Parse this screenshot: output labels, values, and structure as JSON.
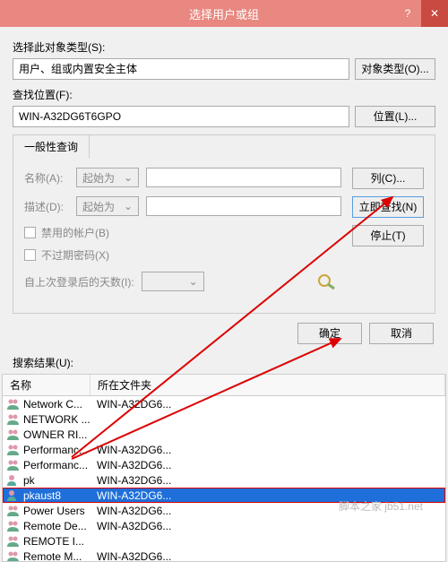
{
  "title": "选择用户或组",
  "section1": {
    "label": "选择此对象类型(S):",
    "value": "用户、组或内置安全主体",
    "btn": "对象类型(O)..."
  },
  "section2": {
    "label": "查找位置(F):",
    "value": "WIN-A32DG6T6GPO",
    "btn": "位置(L)..."
  },
  "tab": "一般性查询",
  "query": {
    "nameLabel": "名称(A):",
    "nameMode": "起始为",
    "descLabel": "描述(D):",
    "descMode": "起始为",
    "cb1": "禁用的帐户(B)",
    "cb2": "不过期密码(X)",
    "lastLogin": "自上次登录后的天数(I):"
  },
  "rightButtons": {
    "columns": "列(C)...",
    "findNow": "立即查找(N)",
    "stop": "停止(T)"
  },
  "dlg": {
    "ok": "确定",
    "cancel": "取消"
  },
  "resultsLabel": "搜索结果(U):",
  "columns": {
    "name": "名称",
    "folder": "所在文件夹"
  },
  "rows": [
    {
      "name": "Network C...",
      "folder": "WIN-A32DG6...",
      "type": "group",
      "sel": false
    },
    {
      "name": "NETWORK ...",
      "folder": "",
      "type": "group",
      "sel": false
    },
    {
      "name": "OWNER RI...",
      "folder": "",
      "type": "group",
      "sel": false
    },
    {
      "name": "Performanc...",
      "folder": "WIN-A32DG6...",
      "type": "group",
      "sel": false
    },
    {
      "name": "Performanc...",
      "folder": "WIN-A32DG6...",
      "type": "group",
      "sel": false
    },
    {
      "name": "pk",
      "folder": "WIN-A32DG6...",
      "type": "user",
      "sel": false
    },
    {
      "name": "pkaust8",
      "folder": "WIN-A32DG6...",
      "type": "user",
      "sel": true
    },
    {
      "name": "Power Users",
      "folder": "WIN-A32DG6...",
      "type": "group",
      "sel": false
    },
    {
      "name": "Remote De...",
      "folder": "WIN-A32DG6...",
      "type": "group",
      "sel": false
    },
    {
      "name": "REMOTE I...",
      "folder": "",
      "type": "group",
      "sel": false
    },
    {
      "name": "Remote M...",
      "folder": "WIN-A32DG6...",
      "type": "group",
      "sel": false
    }
  ],
  "watermark": "脚本之家 jb51.net"
}
